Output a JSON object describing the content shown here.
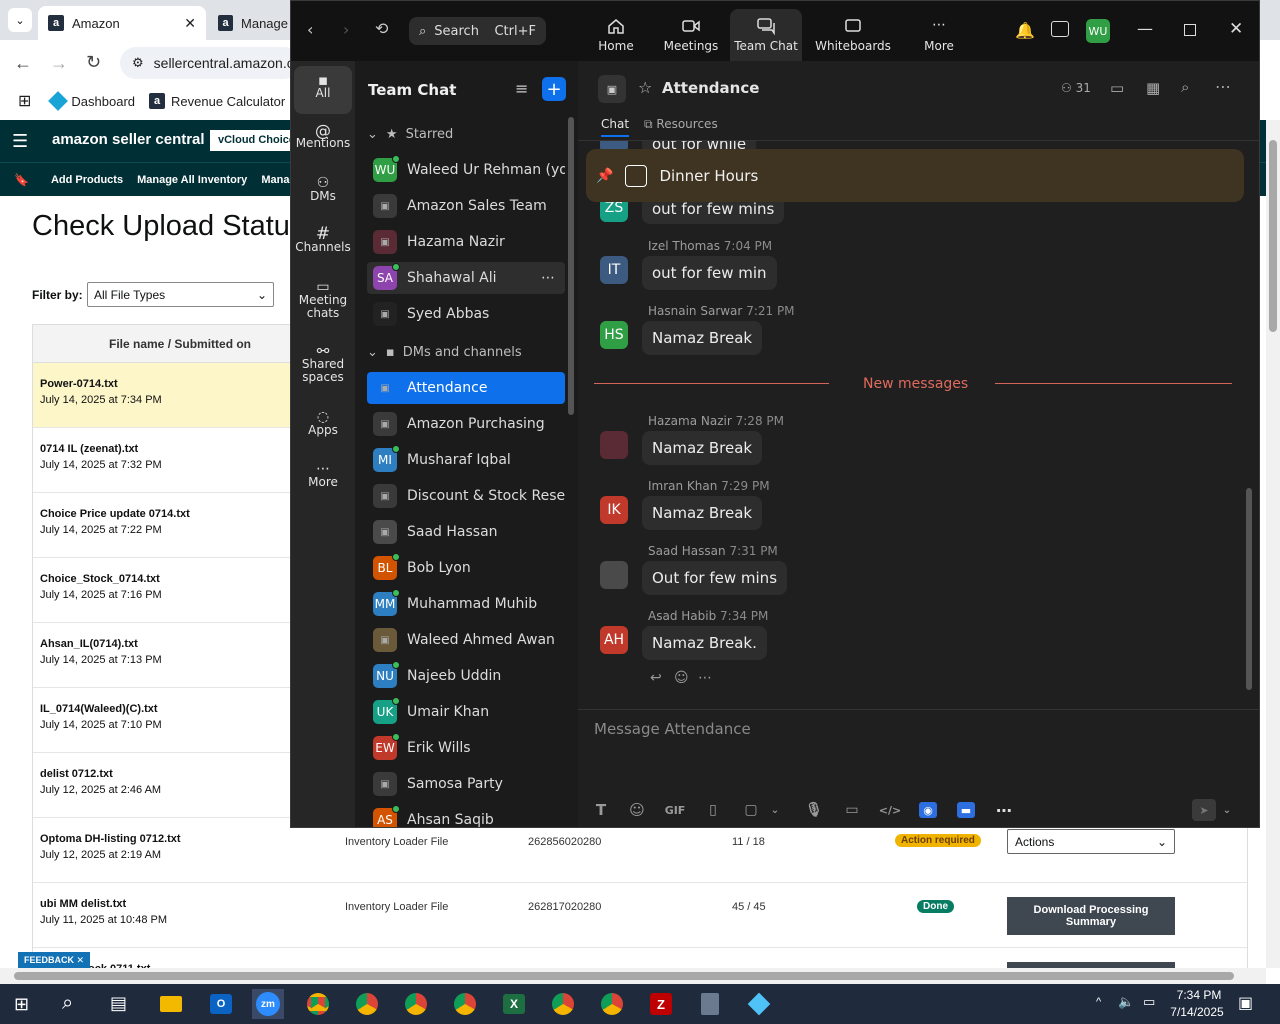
{
  "browser": {
    "tabs": [
      {
        "title": "Amazon"
      },
      {
        "title": "Manage"
      }
    ],
    "url": "sellercentral.amazon.c",
    "bookmarks": [
      "Dashboard",
      "Revenue Calculator"
    ]
  },
  "seller": {
    "logo": "amazon seller central",
    "account": "vCloud Choice",
    "nav": [
      "Add Products",
      "Manage All Inventory",
      "Manage C"
    ],
    "page_title": "Check Upload Status",
    "filter_label": "Filter by:",
    "filter_value": "All File Types",
    "column_header": "File name / Submitted on",
    "rows": [
      {
        "name": "Power-0714.txt",
        "date": "July 14, 2025 at 7:34 PM"
      },
      {
        "name": "0714 IL (zeenat).txt",
        "date": "July 14, 2025 at 7:32 PM"
      },
      {
        "name": "Choice Price update 0714.txt",
        "date": "July 14, 2025 at 7:22 PM"
      },
      {
        "name": "Choice_Stock_0714.txt",
        "date": "July 14, 2025 at 7:16 PM"
      },
      {
        "name": "Ahsan_IL(0714).txt",
        "date": "July 14, 2025 at 7:13 PM"
      },
      {
        "name": "IL_0714(Waleed)(C).txt",
        "date": "July 14, 2025 at 7:10 PM"
      },
      {
        "name": "delist 0712.txt",
        "date": "July 12, 2025 at 2:46 AM"
      },
      {
        "name": "Optoma DH-listing 0712.txt",
        "date": "July 12, 2025 at 2:19 AM",
        "type": "Inventory Loader File",
        "batch": "262856020280",
        "records": "11 / 18",
        "status": "Action required",
        "action": "Actions"
      },
      {
        "name": "ubi MM delist.txt",
        "date": "July 11, 2025 at 10:48 PM",
        "type": "Inventory Loader File",
        "batch": "262817020280",
        "records": "45 / 45",
        "status": "Done",
        "action": "Download Processing Summary"
      },
      {
        "name": "ock 0711.txt",
        "date": ""
      }
    ],
    "feedback": "FEEDBACK"
  },
  "zoom": {
    "search": "Search",
    "search_shortcut": "Ctrl+F",
    "nav": [
      {
        "label": "Home",
        "icon": "home-icon"
      },
      {
        "label": "Meetings",
        "icon": "video-icon"
      },
      {
        "label": "Team Chat",
        "icon": "chat-icon"
      },
      {
        "label": "Whiteboards",
        "icon": "whiteboard-icon"
      },
      {
        "label": "More",
        "icon": "more-icon"
      }
    ],
    "user_initials": "WU",
    "rail": [
      {
        "label": "All"
      },
      {
        "label": "Mentions"
      },
      {
        "label": "DMs"
      },
      {
        "label": "Channels"
      },
      {
        "label": "Meeting chats"
      },
      {
        "label": "Shared spaces"
      },
      {
        "label": "Apps"
      },
      {
        "label": "More"
      }
    ],
    "list_title": "Team Chat",
    "starred_label": "Starred",
    "starred": [
      {
        "name": "Waleed Ur Rehman (you)",
        "initials": "WU",
        "color": "#2f9e44"
      },
      {
        "name": "Amazon Sales Team",
        "initials": "",
        "color": "#3a3a3a"
      },
      {
        "name": "Hazama Nazir",
        "initials": "",
        "color": "#5a2a35"
      },
      {
        "name": "Shahawal Ali",
        "initials": "SA",
        "color": "#8e44ad"
      },
      {
        "name": "Syed Abbas",
        "initials": "",
        "color": "#222"
      }
    ],
    "dms_label": "DMs and channels",
    "dms": [
      {
        "name": "Attendance",
        "initials": "",
        "color": "#0e71eb"
      },
      {
        "name": "Amazon Purchasing",
        "initials": "",
        "color": "#3a3a3a"
      },
      {
        "name": "Musharaf Iqbal",
        "initials": "MI",
        "color": "#2d7fc1"
      },
      {
        "name": "Discount & Stock Reser...",
        "initials": "",
        "color": "#3a3a3a"
      },
      {
        "name": "Saad Hassan",
        "initials": "",
        "color": "#4a4a4a"
      },
      {
        "name": "Bob Lyon",
        "initials": "BL",
        "color": "#d35400"
      },
      {
        "name": "Muhammad Muhib",
        "initials": "MM",
        "color": "#2d7fc1"
      },
      {
        "name": "Waleed Ahmed Awan",
        "initials": "",
        "color": "#6b5a3a"
      },
      {
        "name": "Najeeb Uddin",
        "initials": "NU",
        "color": "#2d7fc1"
      },
      {
        "name": "Umair Khan",
        "initials": "UK",
        "color": "#16a085"
      },
      {
        "name": "Erik Wills",
        "initials": "EW",
        "color": "#c0392b"
      },
      {
        "name": "Samosa Party",
        "initials": "",
        "color": "#3a3a3a"
      },
      {
        "name": "Ahsan Saqib",
        "initials": "AS",
        "color": "#d35400"
      }
    ],
    "channel": {
      "name": "Attendance",
      "members": "31",
      "tabs": [
        "Chat",
        "Resources"
      ],
      "pinned": "Dinner Hours",
      "partial_top": "out for while",
      "partial_bubble": "out for few mins",
      "partial_initials": "ZS",
      "messages_before": [
        {
          "name": "Izel Thomas",
          "time": "7:04 PM",
          "text": "out for few min",
          "initials": "IT",
          "color": "#3d5a80"
        },
        {
          "name": "Hasnain Sarwar",
          "time": "7:21 PM",
          "text": "Namaz Break",
          "initials": "HS",
          "color": "#2f9e44"
        }
      ],
      "new_messages": "New messages",
      "messages_after": [
        {
          "name": "Hazama Nazir",
          "time": "7:28 PM",
          "text": "Namaz Break",
          "initials": "",
          "color": "#5a2a35"
        },
        {
          "name": "Imran Khan",
          "time": "7:29 PM",
          "text": "Namaz Break",
          "initials": "IK",
          "color": "#c0392b"
        },
        {
          "name": "Saad Hassan",
          "time": "7:31 PM",
          "text": "Out for few mins",
          "initials": "",
          "color": "#4a4a4a"
        },
        {
          "name": "Asad Habib",
          "time": "7:34 PM",
          "text": "Namaz Break.",
          "initials": "AH",
          "color": "#c0392b"
        }
      ],
      "composer_placeholder": "Message Attendance"
    }
  },
  "taskbar": {
    "time": "7:34 PM",
    "date": "7/14/2025"
  }
}
